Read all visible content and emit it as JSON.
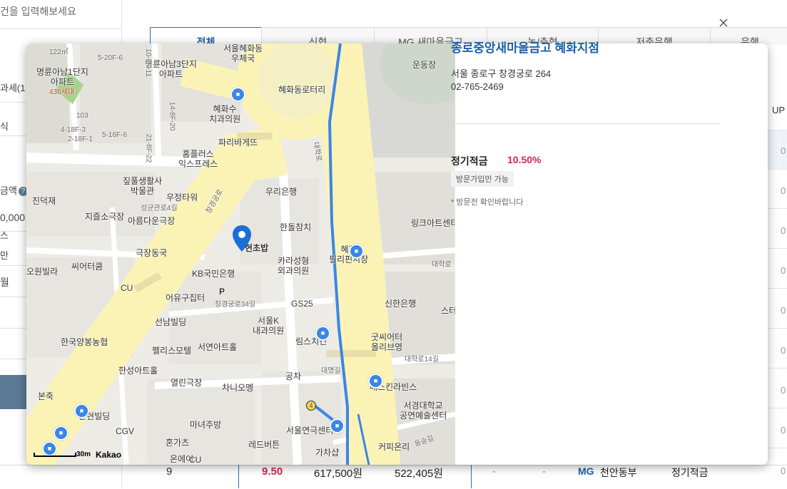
{
  "background": {
    "search_placeholder": "건을 입력해보세요",
    "fragments": {
      "f1": "과세(1",
      "f2": "식",
      "f3": "금액",
      "f4": "0,000",
      "f5": "스",
      "f6": "만",
      "f7": "월",
      "help": "?"
    },
    "tabs": [
      {
        "label": "전체"
      },
      {
        "label": "신협"
      },
      {
        "label": "MG 새마을금고"
      },
      {
        "label": "농/축협"
      },
      {
        "label": "저축은행"
      },
      {
        "label": "은행"
      }
    ],
    "col_header": "UP",
    "row_values": [
      "0",
      "0",
      "0",
      "0",
      "0",
      "0",
      "0",
      "0",
      "0",
      "0",
      "0"
    ],
    "bottom_row": {
      "rank": "9",
      "rate": "9.50",
      "amount1": "617,500원",
      "amount2": "522,405원",
      "dash1": "-",
      "dash2": "-",
      "bank_logo": "MG",
      "bank_name": "천안동부",
      "product": "정기적금",
      "last": "0"
    }
  },
  "modal": {
    "title": "종로중앙새마을금고 혜화지점",
    "address": "서울 종로구 창경궁로 264",
    "phone": "02-765-2469",
    "product_name": "정기적금",
    "product_rate": "10.50%",
    "badge": "방문가입만 가능",
    "note": "* 방문전 확인바랍니다"
  },
  "map": {
    "labels": {
      "l1": "명륜아남1단지",
      "l2": "아파트",
      "l3": "436세대",
      "l4": "5-20F-6",
      "l5": "명륜아남3단지",
      "l6": "아파트",
      "l7": "혜화수",
      "l8": "치과의원",
      "l9": "파리바게뜨",
      "l10": "홈플러스",
      "l11": "익스프레스",
      "l12": "서울혜화동",
      "l13": "우체국",
      "l14": "혜화동로터리",
      "l15": "운동장",
      "l16": "짚풀생활사",
      "l17": "박물관",
      "l18": "진덕재",
      "l19": "우정타워",
      "l20": "우리은행",
      "l21": "지즐소극장",
      "l22": "아름다운극장",
      "l23": "한돌참치",
      "l24": "링크아트센터",
      "l25": "극장동국",
      "l26": "현초밥",
      "l27": "카라성형",
      "l28": "외과의원",
      "l29": "혜화",
      "l30": "필리핀시장",
      "l31": "씨어터쿰",
      "l32": "KB국민은행",
      "l33": "CU",
      "l34": "어유구집터",
      "l35": "GS25",
      "l36": "신한은행",
      "l37": "선남빌딩",
      "l38": "서울K",
      "l39": "내과의원",
      "l40": "림스치킨",
      "l41": "한국양봉농협",
      "l42": "펠리스모텔",
      "l43": "서연아트홀",
      "l44": "굿씨어터",
      "l45": "올리브영",
      "l46": "한성아트홀",
      "l47": "열린극장",
      "l48": "차니오멩",
      "l49": "공차",
      "l50": "배스킨라빈스",
      "l51": "본죽",
      "l52": "한현빌딩",
      "l53": "CGV",
      "l54": "마녀주방",
      "l55": "서울연극센터",
      "l56": "서경대학교",
      "l57": "공연예술센터",
      "l58": "혼가츠",
      "l59": "레드버튼",
      "l60": "커피온리",
      "l61": "온에어",
      "l62": "가차샵",
      "l63": "창경궁로",
      "l64": "대학로",
      "l65": "성균관로4길",
      "l66": "창경궁로34길",
      "l67": "대명길",
      "l68": "대학로14길",
      "l69": "122㎡",
      "l70": "103",
      "l71": "4-18F-3",
      "l72": "2-18F-1",
      "l73": "5-16F-6",
      "l74": "10-8F-11",
      "l75": "14-8F-20",
      "l76": "21-8F-22",
      "l77": "오원빌라",
      "l78": "스터",
      "l79": "대학로",
      "l80": "동숭길",
      "l81": "CU",
      "l82": "P",
      "l83": "4"
    },
    "scale": "30m",
    "brand": "Kakao"
  },
  "colors": {
    "accent_blue": "#1d5fa8",
    "rate_red": "#d4284f",
    "road_yellow": "#fbf3b6",
    "route_blue": "#3a86e6"
  }
}
